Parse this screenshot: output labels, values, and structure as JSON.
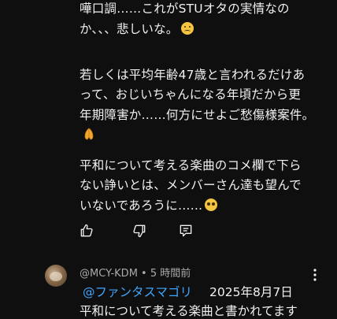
{
  "comment": {
    "lines": [
      "嘩口調……これがSTUオタの実情なの",
      "か、、、悲しいな。",
      "若しくは平均年齢47歳と言われるだけあ",
      "って、おじいちゃんになる年頃だから更",
      "年期障害か……何方にせよご愁傷様案件。",
      "平和について考える楽曲のコメ欄で下ら",
      "ない諍いとは、メンバーさん達も望んで",
      "いないであろうに……"
    ]
  },
  "actions": {
    "like_icon": "thumbs-up-icon",
    "dislike_icon": "thumbs-down-icon",
    "reply_icon": "reply-icon"
  },
  "reply": {
    "author": "@MCY-KDM",
    "separator": "•",
    "time": "5 時間前",
    "mention": "@ファンタスマゴリ",
    "date": "2025年8月7日",
    "text": "平和について考える楽曲と書かれてます"
  },
  "colors": {
    "background": "#0f0f0f",
    "text": "#f1f1f1",
    "secondary": "#aaaaaa",
    "link": "#3ea6ff"
  }
}
